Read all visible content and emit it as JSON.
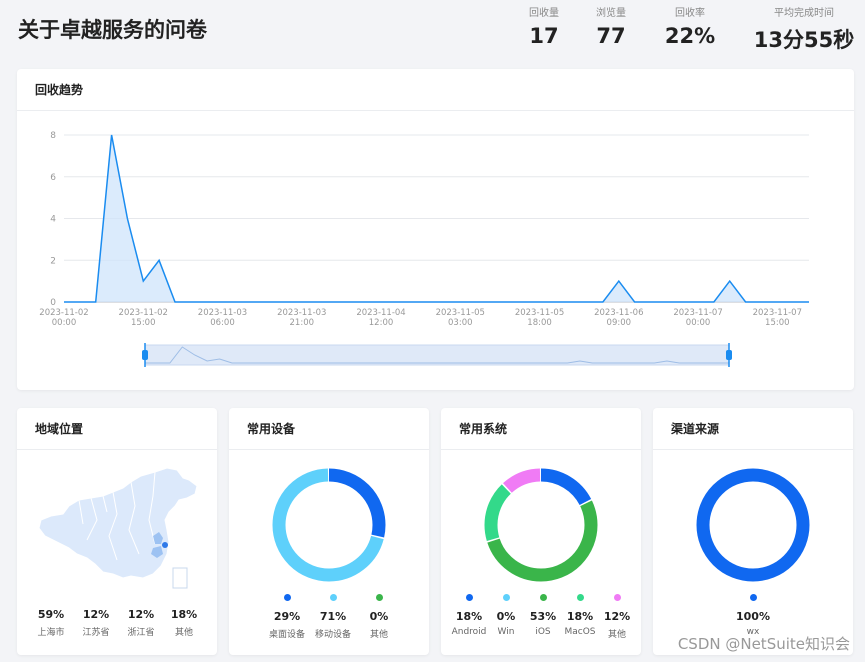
{
  "title": "关于卓越服务的问卷",
  "stats": [
    {
      "label": "回收量",
      "value": "17"
    },
    {
      "label": "浏览量",
      "value": "77"
    },
    {
      "label": "回收率",
      "value": "22%"
    },
    {
      "label": "平均完成时间",
      "value": "13分55秒"
    }
  ],
  "trend": {
    "title": "回收趋势"
  },
  "chart_data": {
    "type": "area",
    "title": "回收趋势",
    "xlabel": "",
    "ylabel": "",
    "ylim": [
      0,
      8
    ],
    "y_ticks": [
      0,
      2,
      4,
      6,
      8
    ],
    "x_tick_labels": [
      [
        "2023-11-02",
        "00:00"
      ],
      [
        "2023-11-02",
        "15:00"
      ],
      [
        "2023-11-03",
        "06:00"
      ],
      [
        "2023-11-03",
        "21:00"
      ],
      [
        "2023-11-04",
        "12:00"
      ],
      [
        "2023-11-05",
        "03:00"
      ],
      [
        "2023-11-05",
        "18:00"
      ],
      [
        "2023-11-06",
        "09:00"
      ],
      [
        "2023-11-07",
        "00:00"
      ],
      [
        "2023-11-07",
        "15:00"
      ]
    ],
    "x_hours": [
      0,
      6,
      9,
      12,
      15,
      18,
      21,
      24,
      102,
      105,
      108,
      123,
      126,
      129
    ],
    "values": [
      0,
      0,
      8,
      4,
      1,
      2,
      0,
      0,
      0,
      1,
      0,
      0,
      1,
      0
    ],
    "x_max_hours": 141,
    "color": "#1a8cf0",
    "fill": "#cfe4fb",
    "grid": true,
    "data_zoom": true
  },
  "region": {
    "title": "地域位置",
    "items": [
      {
        "pct": "59%",
        "name": "上海市"
      },
      {
        "pct": "12%",
        "name": "江苏省"
      },
      {
        "pct": "12%",
        "name": "浙江省"
      },
      {
        "pct": "18%",
        "name": "其他"
      }
    ]
  },
  "device": {
    "title": "常用设备",
    "items": [
      {
        "pct": "29%",
        "name": "桌面设备",
        "color": "#1068f0",
        "value": 29
      },
      {
        "pct": "71%",
        "name": "移动设备",
        "color": "#5ed0fb",
        "value": 71
      },
      {
        "pct": "0%",
        "name": "其他",
        "color": "#3ab54a",
        "value": 0
      }
    ]
  },
  "os": {
    "title": "常用系统",
    "items": [
      {
        "pct": "18%",
        "name": "Android",
        "color": "#1068f0",
        "value": 18
      },
      {
        "pct": "0%",
        "name": "Win",
        "color": "#5ed0fb",
        "value": 0
      },
      {
        "pct": "53%",
        "name": "iOS",
        "color": "#3ab54a",
        "value": 53
      },
      {
        "pct": "18%",
        "name": "MacOS",
        "color": "#33d98a",
        "value": 18
      },
      {
        "pct": "12%",
        "name": "其他",
        "color": "#f07bf5",
        "value": 12
      }
    ]
  },
  "channel": {
    "title": "渠道来源",
    "items": [
      {
        "pct": "100%",
        "name": "wx",
        "color": "#1068f0",
        "value": 100
      }
    ]
  },
  "watermark": "CSDN @NetSuite知识会"
}
